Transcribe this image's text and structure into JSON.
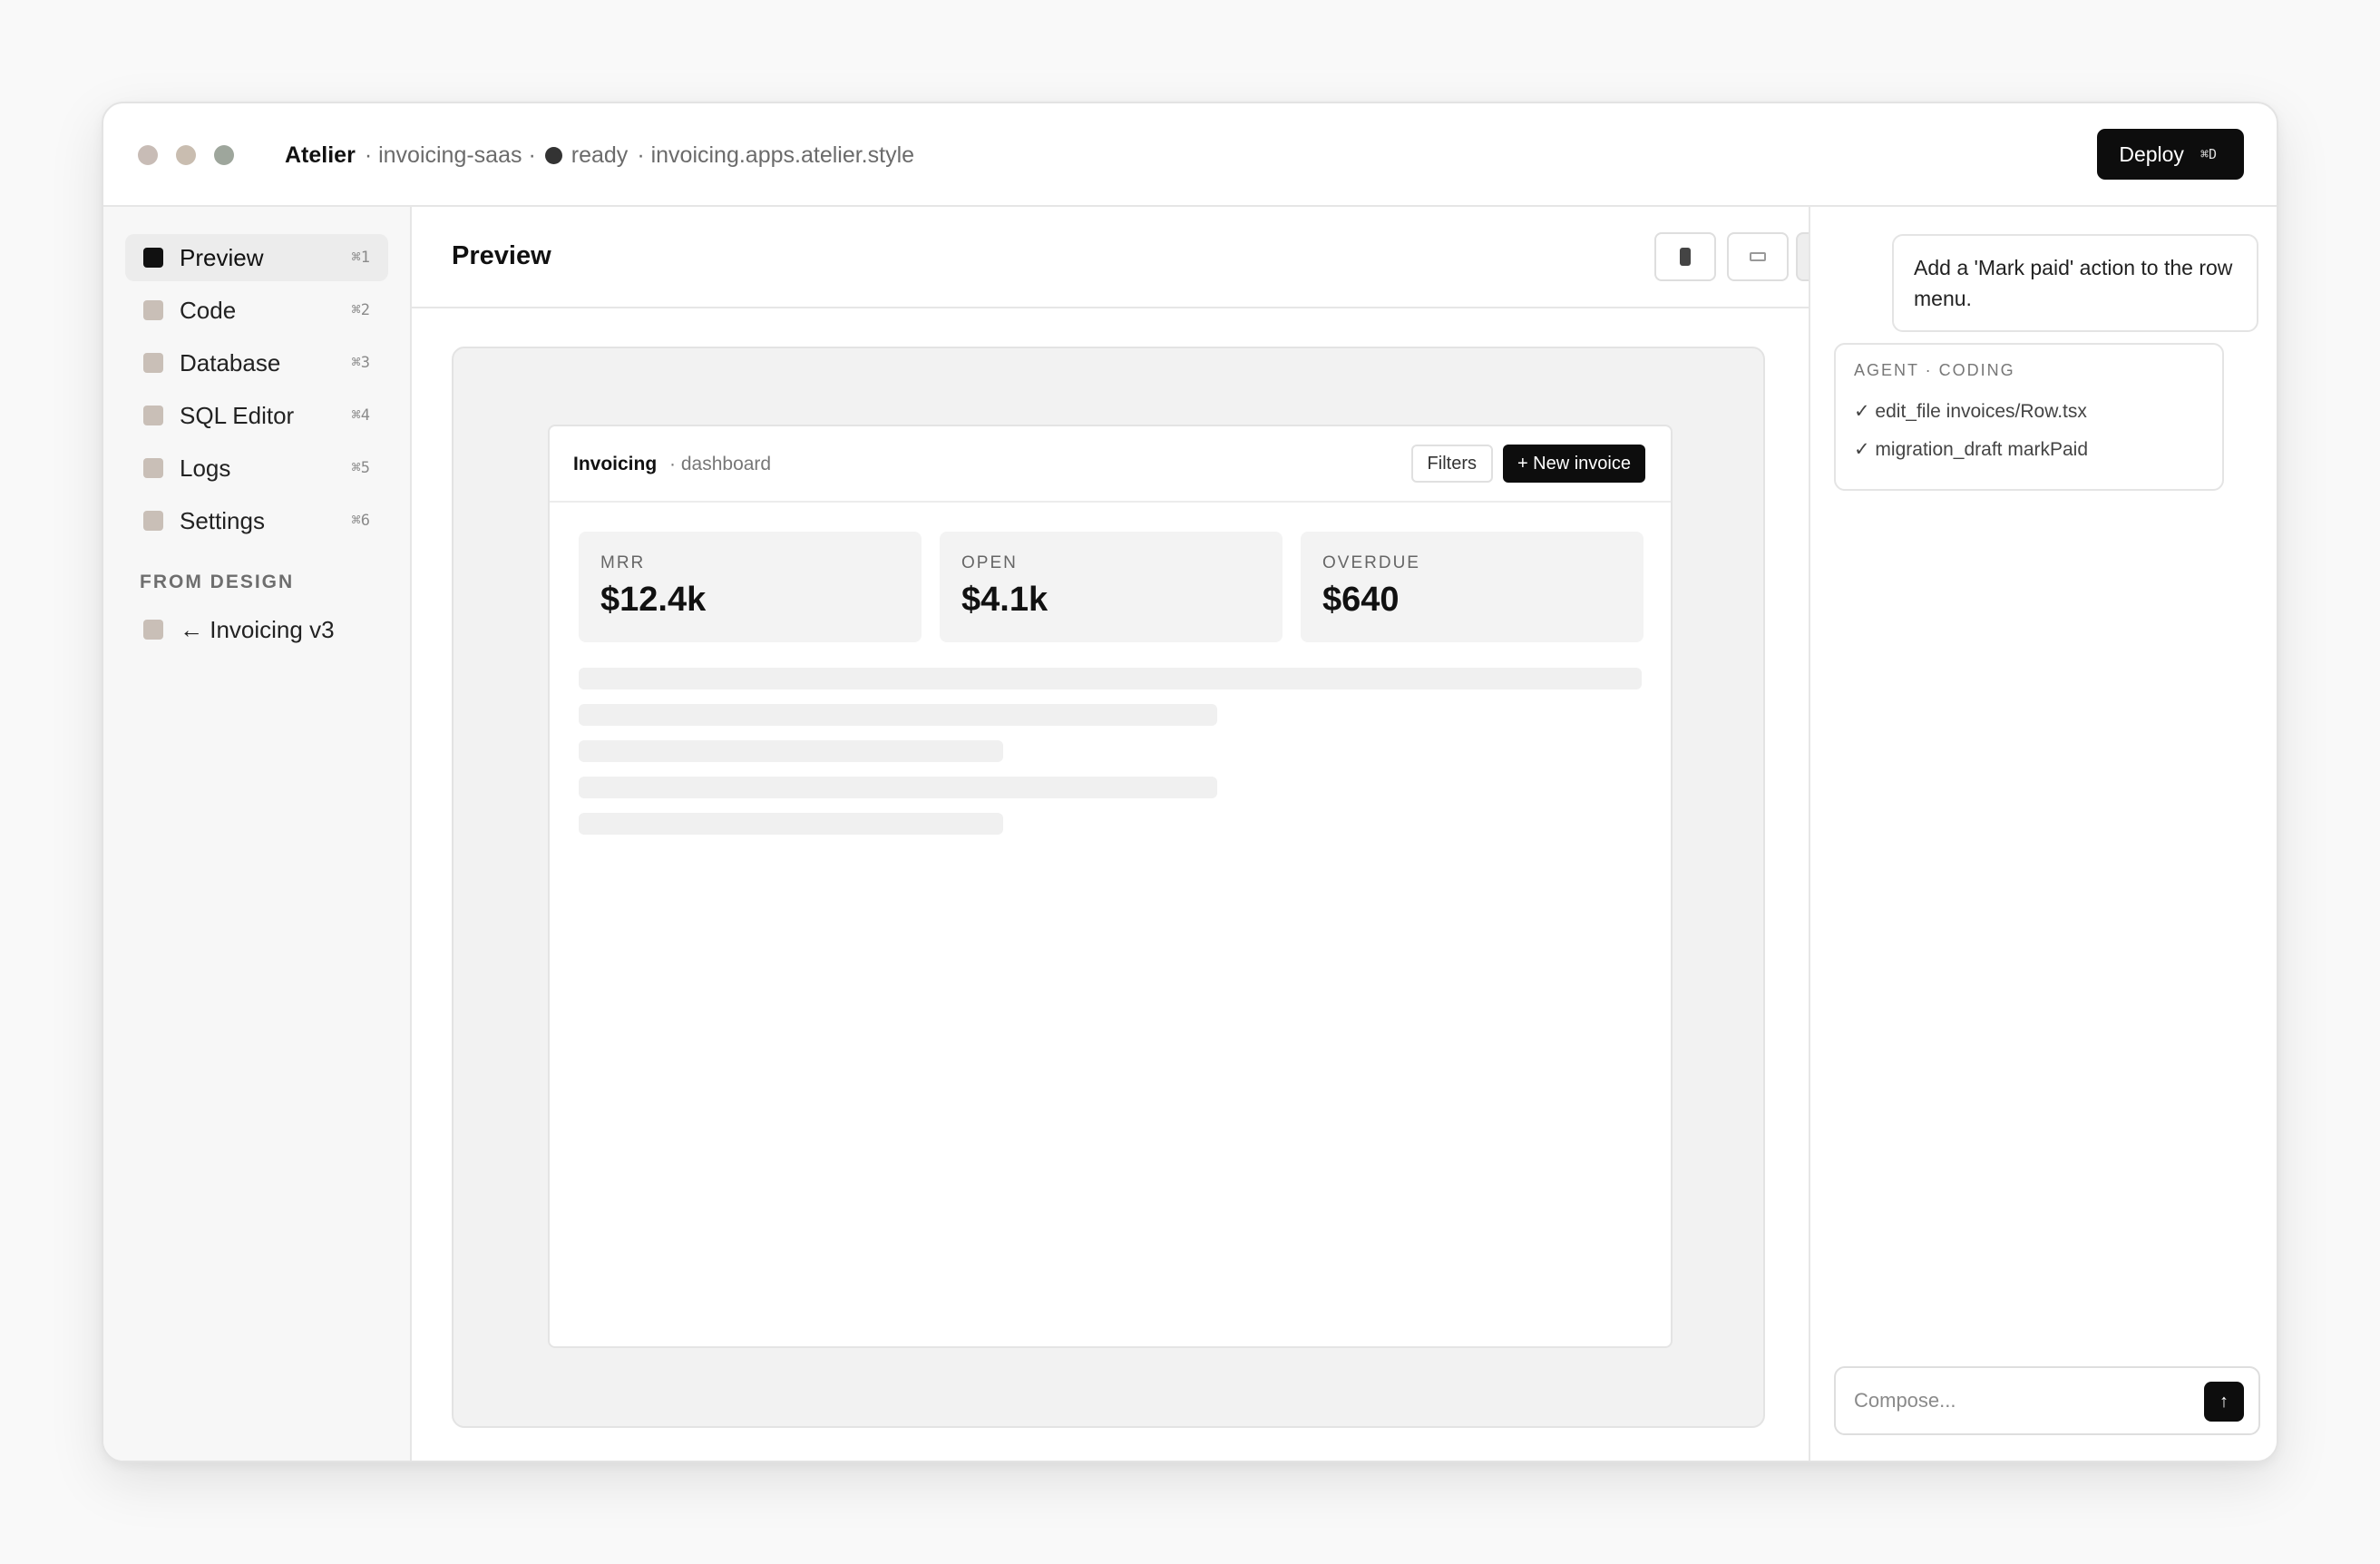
{
  "colors": {
    "dot_1": "#c8bcb6",
    "dot_2": "#c9bdb0",
    "dot_3": "#9ea69c",
    "accent": "#0d0d0d"
  },
  "titlebar": {
    "brand": "Atelier",
    "project": "· invoicing-saas ·",
    "status": "ready",
    "domain": "· invoicing.apps.atelier.style",
    "deploy_label": "Deploy",
    "deploy_shortcut": "⌘D"
  },
  "sidebar": {
    "items": [
      {
        "label": "Preview",
        "shortcut": "⌘1"
      },
      {
        "label": "Code",
        "shortcut": "⌘2"
      },
      {
        "label": "Database",
        "shortcut": "⌘3"
      },
      {
        "label": "SQL Editor",
        "shortcut": "⌘4"
      },
      {
        "label": "Logs",
        "shortcut": "⌘5"
      },
      {
        "label": "Settings",
        "shortcut": "⌘6"
      }
    ],
    "section_label": "FROM DESIGN",
    "design_item": "← Invoicing v3"
  },
  "main": {
    "title": "Preview",
    "view_icons": [
      "phone-icon",
      "tablet-icon",
      "desktop-icon"
    ]
  },
  "app_preview": {
    "title": "Invoicing",
    "subtitle": "· dashboard",
    "filters_label": "Filters",
    "new_label": "+ New invoice",
    "stats": [
      {
        "label": "MRR",
        "value": "$12.4k"
      },
      {
        "label": "OPEN",
        "value": "$4.1k"
      },
      {
        "label": "OVERDUE",
        "value": "$640"
      }
    ]
  },
  "chat": {
    "user_message": "Add a 'Mark paid' action to the row menu.",
    "agent_header": "AGENT · CODING",
    "agent_steps": [
      "✓ edit_file invoices/Row.tsx",
      "✓ migration_draft markPaid"
    ],
    "compose_placeholder": "Compose...",
    "send_icon": "↑"
  }
}
